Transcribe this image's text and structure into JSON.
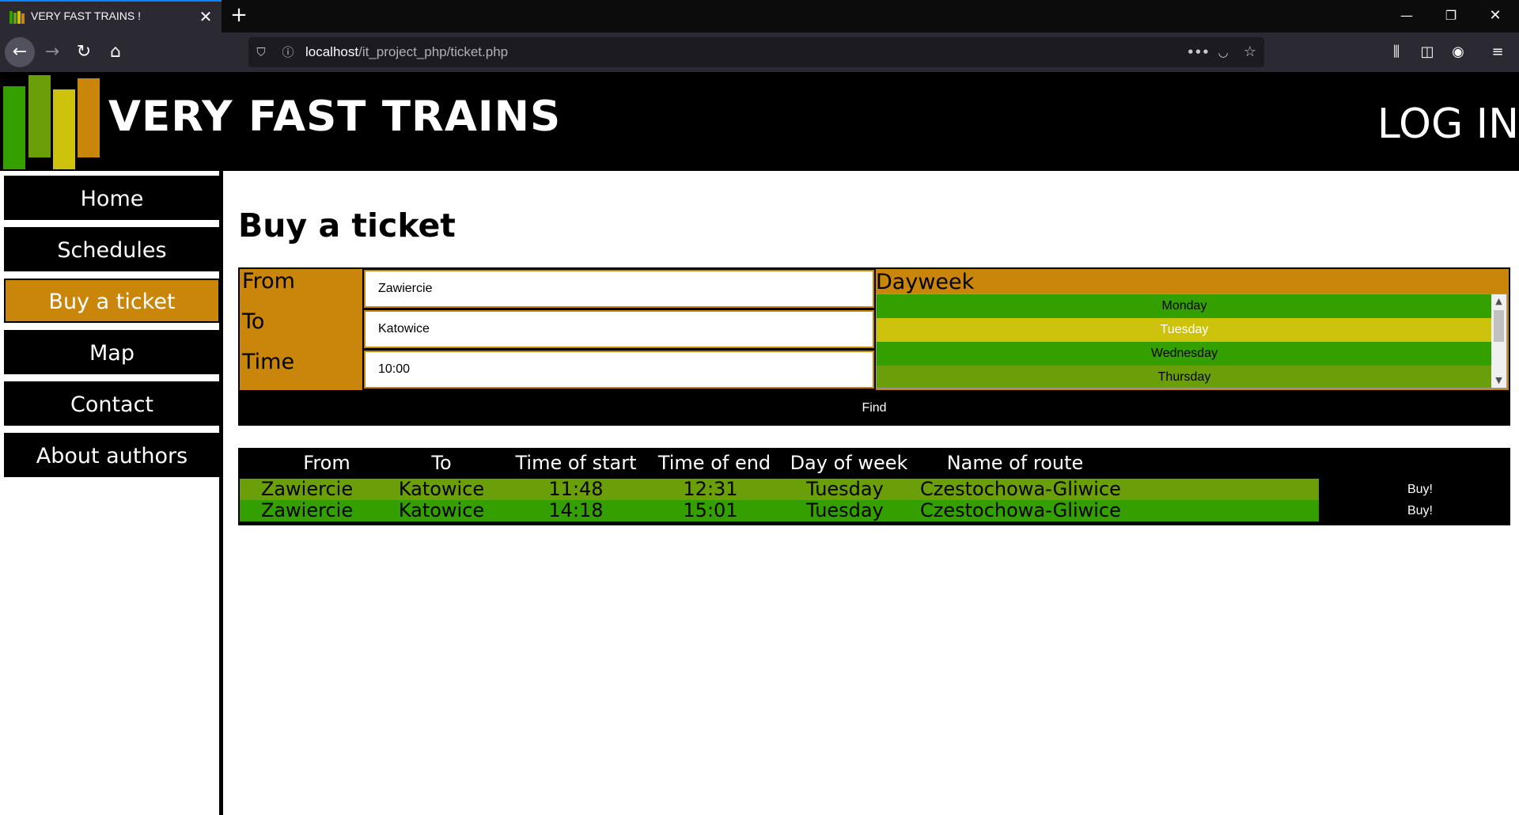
{
  "browser": {
    "tab_title": "VERY FAST TRAINS !",
    "url_host": "localhost",
    "url_path": "/it_project_php/ticket.php"
  },
  "site": {
    "title": "VERY FAST TRAINS",
    "login": "LOG IN",
    "logo_colors": [
      "#33a000",
      "#6a9f0a",
      "#cdc30c",
      "#c9860a"
    ]
  },
  "sidebar": {
    "items": [
      {
        "label": "Home"
      },
      {
        "label": "Schedules"
      },
      {
        "label": "Buy a ticket",
        "active": true
      },
      {
        "label": "Map"
      },
      {
        "label": "Contact"
      },
      {
        "label": "About authors"
      }
    ]
  },
  "main": {
    "title": "Buy a ticket",
    "form": {
      "from_label": "From",
      "to_label": "To",
      "time_label": "Time",
      "from_value": "Zawiercie",
      "to_value": "Katowice",
      "time_value": "10:00",
      "dayweek_label": "Dayweek",
      "days": [
        {
          "label": "Monday",
          "color": "#33a000"
        },
        {
          "label": "Tuesday",
          "color": "#cdc30c",
          "selected": true
        },
        {
          "label": "Wednesday",
          "color": "#33a000"
        },
        {
          "label": "Thursday",
          "color": "#6a9f0a"
        }
      ],
      "find_label": "Find"
    },
    "results": {
      "headers": [
        "From",
        "To",
        "Time of start",
        "Time of end",
        "Day of week",
        "Name of route"
      ],
      "rows": [
        {
          "cells": [
            "Zawiercie",
            "Katowice",
            "11:48",
            "12:31",
            "Tuesday",
            "Czestochowa-Gliwice"
          ],
          "buy": "Buy!",
          "color": "#6a9f0a"
        },
        {
          "cells": [
            "Zawiercie",
            "Katowice",
            "14:18",
            "15:01",
            "Tuesday",
            "Czestochowa-Gliwice"
          ],
          "buy": "Buy!",
          "color": "#33a000"
        }
      ]
    }
  },
  "colors": {
    "accent": "#c9860a",
    "selected_day_text": "#ffffff"
  }
}
